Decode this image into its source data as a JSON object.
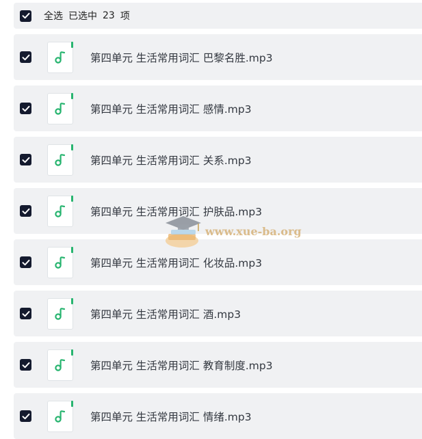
{
  "header": {
    "select_all_label": "全选",
    "selected_label": "已选中",
    "selected_count": "23",
    "unit_label": "项"
  },
  "files": [
    {
      "name": "第四单元 生活常用词汇 巴黎名胜.mp3",
      "checked": true
    },
    {
      "name": "第四单元 生活常用词汇 感情.mp3",
      "checked": true
    },
    {
      "name": "第四单元 生活常用词汇 关系.mp3",
      "checked": true
    },
    {
      "name": "第四单元 生活常用词汇 护肤品.mp3",
      "checked": true
    },
    {
      "name": "第四单元 生活常用词汇 化妆品.mp3",
      "checked": true
    },
    {
      "name": "第四单元 生活常用词汇 酒.mp3",
      "checked": true
    },
    {
      "name": "第四单元 生活常用词汇 教育制度.mp3",
      "checked": true
    },
    {
      "name": "第四单元 生活常用词汇 情绪.mp3",
      "checked": true
    }
  ],
  "icons": {
    "checkbox": "checkmark-icon",
    "file": "music-note-icon"
  },
  "colors": {
    "checkbox_bg": "#141a2e",
    "row_bg": "#f0f1f3",
    "file_accent": "#27b46f",
    "text": "#333840"
  },
  "watermark": {
    "text": "www.xue-ba.org"
  }
}
